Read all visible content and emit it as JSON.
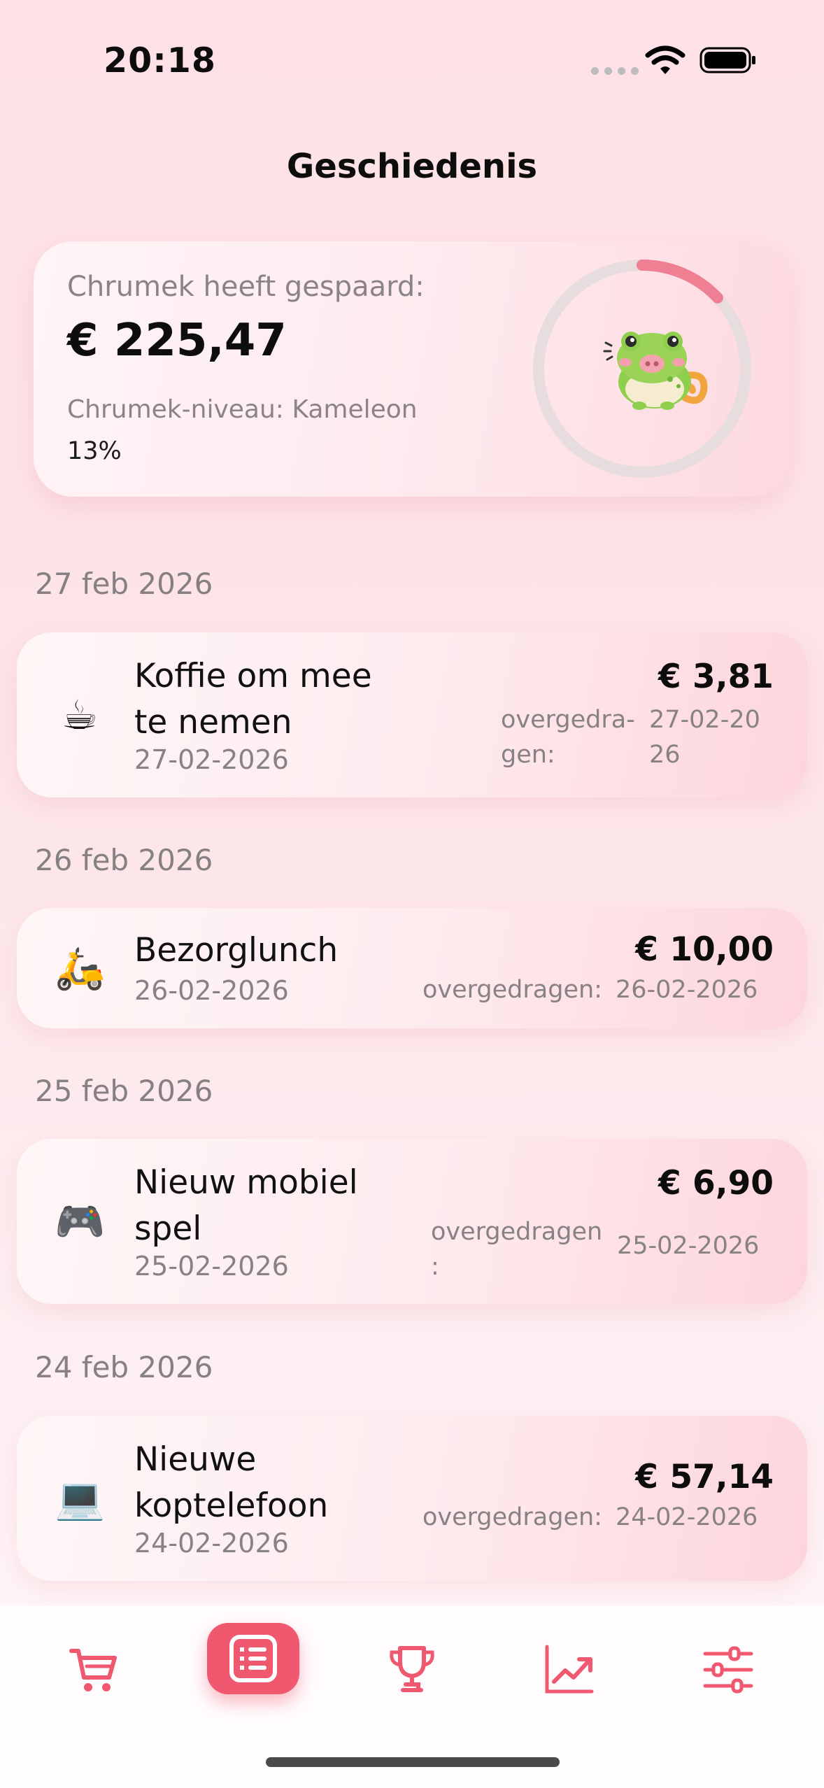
{
  "status_bar": {
    "time": "20:18"
  },
  "header": {
    "title": "Geschiedenis"
  },
  "summary": {
    "saved_label": "Chrumek heeft gespaard:",
    "saved_amount": "€ 225,47",
    "level_label": "Chrumek-niveau: Kameleon",
    "level_percent_text": "13%",
    "progress_fraction": 0.13,
    "mascot": "chameleon-pig-mascot-icon"
  },
  "groups": [
    {
      "date_header": "27 feb 2026",
      "transaction": {
        "icon": "coffee-cup-icon",
        "emoji": "☕",
        "title_lines": [
          "Koffie om mee",
          "te nemen"
        ],
        "date": "27-02-2026",
        "amount": "€ 3,81",
        "transfer_label_lines": [
          "overgedra-",
          "gen:"
        ],
        "transfer_date_lines": [
          "27-02-20",
          "26"
        ]
      }
    },
    {
      "date_header": "26 feb 2026",
      "transaction": {
        "icon": "scooter-icon",
        "emoji": "🛵",
        "title_lines": [
          "Bezorglunch"
        ],
        "date": "26-02-2026",
        "amount": "€ 10,00",
        "transfer_label_lines": [
          "overgedragen:"
        ],
        "transfer_date_lines": [
          "26-02-2026"
        ]
      }
    },
    {
      "date_header": "25 feb 2026",
      "transaction": {
        "icon": "game-controller-icon",
        "emoji": "🎮",
        "title_lines": [
          "Nieuw mobiel",
          "spel"
        ],
        "date": "25-02-2026",
        "amount": "€ 6,90",
        "transfer_label_lines": [
          "overgedragen",
          ":"
        ],
        "transfer_date_lines": [
          "25-02-2026"
        ]
      }
    },
    {
      "date_header": "24 feb 2026",
      "transaction": {
        "icon": "laptop-icon",
        "emoji": "💻",
        "title_lines": [
          "Nieuwe",
          "koptelefoon"
        ],
        "date": "24-02-2026",
        "amount": "€ 57,14",
        "transfer_label_lines": [
          "overgedragen:"
        ],
        "transfer_date_lines": [
          "24-02-2026"
        ]
      }
    }
  ],
  "tab_bar": {
    "items": [
      "cart-icon",
      "history-list-icon",
      "trophy-icon",
      "chart-trend-icon",
      "sliders-icon"
    ],
    "active": "history-list-icon"
  },
  "colors": {
    "accent": "#f0586f",
    "ring_track": "#e6dcdd",
    "ring_fill": "#ef7f92"
  }
}
